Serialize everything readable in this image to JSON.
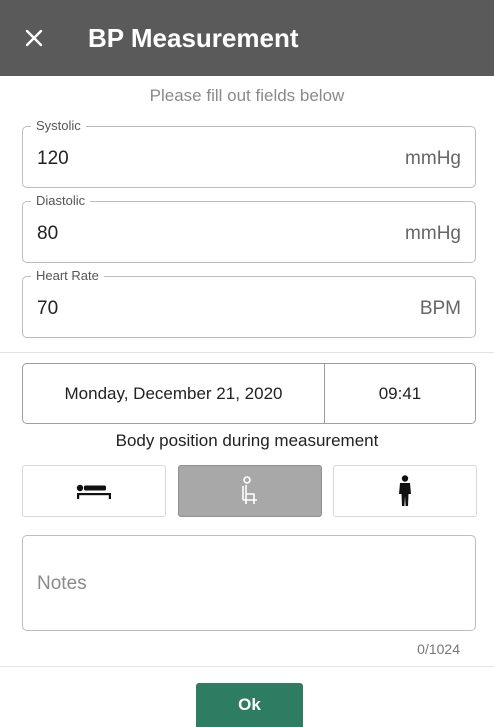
{
  "header": {
    "title": "BP Measurement",
    "close_icon": "close-icon"
  },
  "hint": "Please fill out fields below",
  "fields": [
    {
      "label": "Systolic",
      "value": "120",
      "unit": "mmHg"
    },
    {
      "label": "Diastolic",
      "value": "80",
      "unit": "mmHg"
    },
    {
      "label": "Heart Rate",
      "value": "70",
      "unit": "BPM"
    }
  ],
  "datetime": {
    "date": "Monday, December 21, 2020",
    "time": "09:41"
  },
  "body_position": {
    "label": "Body position during measurement",
    "options": [
      {
        "icon": "lying-person-icon",
        "selected": false
      },
      {
        "icon": "sitting-person-icon",
        "selected": true
      },
      {
        "icon": "standing-person-icon",
        "selected": false
      }
    ]
  },
  "notes": {
    "placeholder": "Notes",
    "counter": "0/1024"
  },
  "ok_label": "Ok",
  "colors": {
    "header_bg": "#5a5a5a",
    "accent": "#2e7d62",
    "selected_bg": "#a8a8a8"
  }
}
